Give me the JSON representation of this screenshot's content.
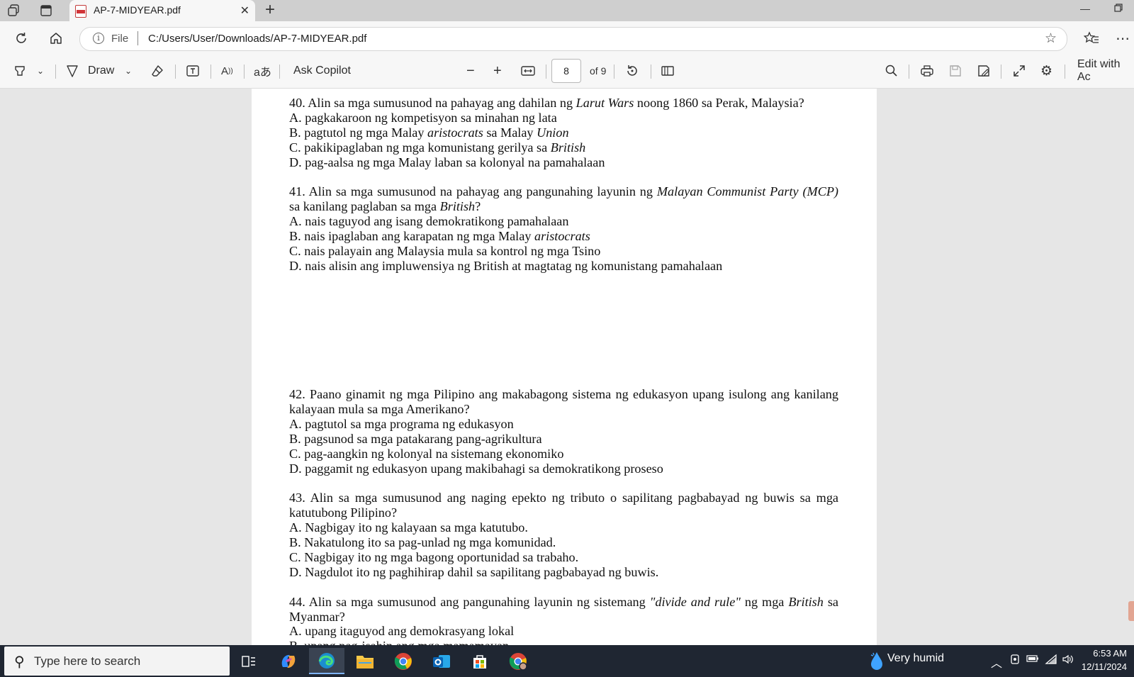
{
  "browser": {
    "tab_title": "AP-7-MIDYEAR.pdf",
    "address_scheme": "File",
    "address_url": "C:/Users/User/Downloads/AP-7-MIDYEAR.pdf"
  },
  "pdf_toolbar": {
    "draw_label": "Draw",
    "copilot_label": "Ask Copilot",
    "current_page": "8",
    "page_count_label": "of 9",
    "edit_label": "Edit with Ac"
  },
  "questions_page1": [
    {
      "stem_parts": [
        "40. Alin sa mga sumusunod na pahayag ang dahilan ng ",
        "Larut Wars",
        " noong 1860 sa Perak, Malaysia?"
      ],
      "options": [
        [
          "A. pagkakaroon ng kompetisyon sa minahan ng lata"
        ],
        [
          "B. pagtutol ng mga Malay ",
          "aristocrats",
          " sa Malay ",
          "Union"
        ],
        [
          "C. pakikipaglaban ng mga komunistang gerilya sa ",
          "British"
        ],
        [
          "D. pag-aalsa ng mga Malay laban sa kolonyal na pamahalaan"
        ]
      ]
    },
    {
      "stem_parts": [
        "41. Alin sa mga sumusunod na pahayag ang pangunahing layunin ng ",
        "Malayan Communist Party (MCP)",
        " sa kanilang paglaban sa mga ",
        "British",
        "?"
      ],
      "options": [
        [
          "A. nais taguyod ang isang demokratikong pamahalaan"
        ],
        [
          "B. nais ipaglaban ang karapatan ng mga Malay ",
          "aristocrats"
        ],
        [
          "C. nais palayain ang Malaysia mula sa kontrol ng mga Tsino"
        ],
        [
          "D. nais alisin ang impluwensiya ng British at magtatag ng komunistang pamahalaan"
        ]
      ]
    }
  ],
  "questions_page2": [
    {
      "stem_parts": [
        "42. Paano ginamit ng mga Pilipino ang makabagong sistema ng edukasyon upang isulong ang kanilang kalayaan mula sa mga Amerikano?"
      ],
      "options": [
        [
          "A. pagtutol sa mga programa ng edukasyon"
        ],
        [
          "B. pagsunod sa mga patakarang pang-agrikultura"
        ],
        [
          "C. pag-aangkin ng kolonyal na sistemang ekonomiko"
        ],
        [
          "D. paggamit ng edukasyon upang makibahagi sa demokratikong proseso"
        ]
      ]
    },
    {
      "stem_parts": [
        "43. Alin sa mga sumusunod ang naging epekto ng tributo o sapilitang pagbabayad ng buwis sa mga katutubong Pilipino?"
      ],
      "options": [
        [
          "A. Nagbigay ito ng kalayaan sa mga katutubo."
        ],
        [
          "B. Nakatulong ito sa pag-unlad ng mga komunidad."
        ],
        [
          "C. Nagbigay ito ng mga bagong oportunidad sa trabaho."
        ],
        [
          "D. Nagdulot ito ng paghihirap dahil sa sapilitang pagbabayad ng buwis."
        ]
      ]
    },
    {
      "stem_parts": [
        "44. Alin sa mga sumusunod ang pangunahing layunin ng sistemang ",
        "\"divide and rule\"",
        " ng mga ",
        "British",
        " sa Myanmar?"
      ],
      "options": [
        [
          "A. upang itaguyod ang demokrasyang lokal"
        ],
        [
          "B. upang pag-isahin ang mga mamamayan"
        ]
      ]
    }
  ],
  "taskbar": {
    "search_placeholder": "Type here to search",
    "weather": "Very humid",
    "time": "6:53 AM",
    "date": "12/11/2024"
  },
  "colors": {
    "edge_accent": "#0078d4",
    "pdf_red": "#d13438",
    "taskbar_bg": "#1f2632"
  }
}
